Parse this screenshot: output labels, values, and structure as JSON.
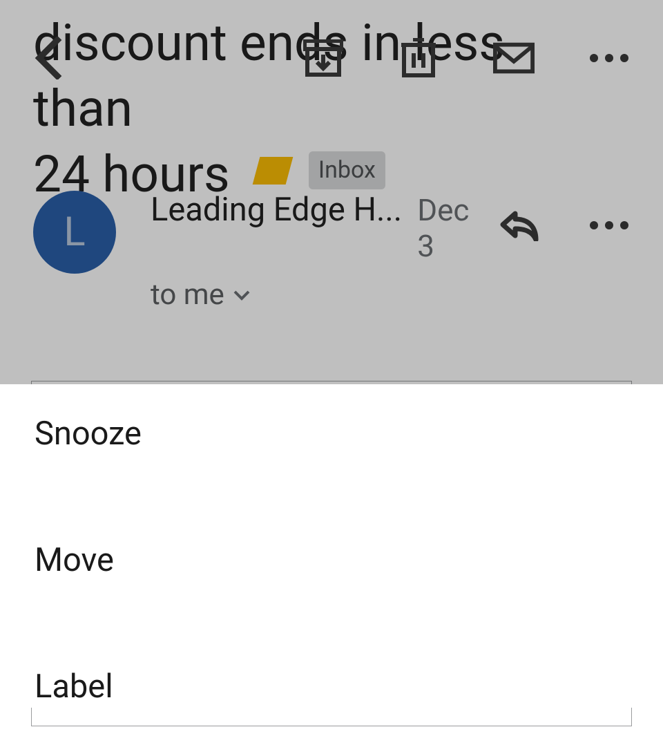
{
  "subject": {
    "line1": "discount ends in less than",
    "line2": "24 hours",
    "label": "Inbox"
  },
  "sender": {
    "avatar_letter": "L",
    "name": "Leading Edge H...",
    "date": "Dec 3",
    "recipient": "to me"
  },
  "sheet": {
    "items": [
      "Snooze",
      "Move",
      "Label"
    ]
  }
}
